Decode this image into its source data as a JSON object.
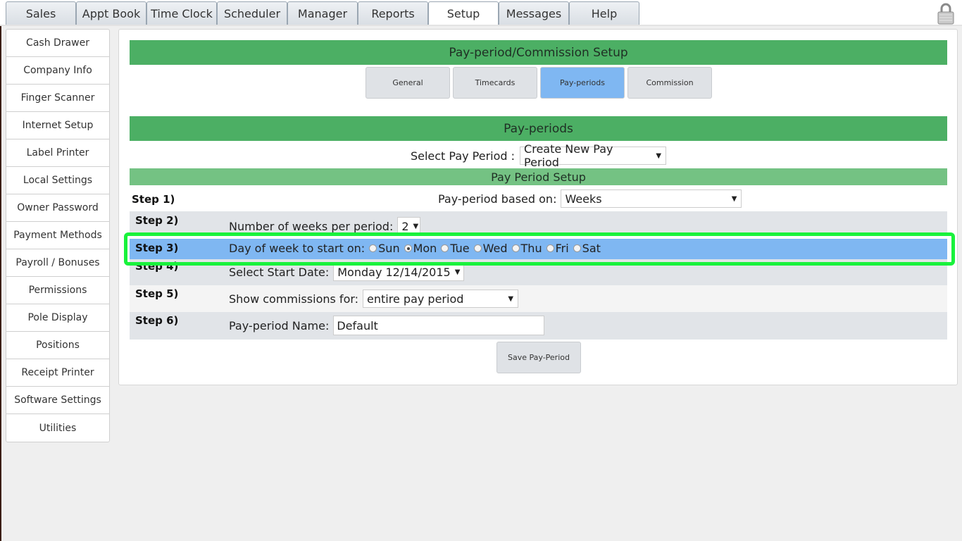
{
  "top_tabs": [
    "Sales",
    "Appt Book",
    "Time Clock",
    "Scheduler",
    "Manager",
    "Reports",
    "Setup",
    "Messages",
    "Help"
  ],
  "sidebar": [
    "Cash Drawer",
    "Company Info",
    "Finger Scanner",
    "Internet Setup",
    "Label Printer",
    "Local Settings",
    "Owner Password",
    "Payment Methods",
    "Payroll / Bonuses",
    "Permissions",
    "Pole Display",
    "Positions",
    "Receipt Printer",
    "Software Settings",
    "Utilities"
  ],
  "header": "Pay-period/Commission Setup",
  "sub_tabs": [
    "General",
    "Timecards",
    "Pay-periods",
    "Commission"
  ],
  "payperiods_title": "Pay-periods",
  "select_pay_period": {
    "label": "Select Pay Period :",
    "value": "Create New Pay Period"
  },
  "setup_title": "Pay Period Setup",
  "steps": {
    "s1": {
      "label": "Step 1)",
      "text": "Pay-period based on:",
      "value": "Weeks"
    },
    "s2": {
      "label": "Step 2)",
      "text": "Number of weeks per period:",
      "value": "2"
    },
    "s3": {
      "label": "Step 3)",
      "text": "Day of week to start on:",
      "days": [
        "Sun",
        "Mon",
        "Tue",
        "Wed",
        "Thu",
        "Fri",
        "Sat"
      ],
      "selected": "Mon"
    },
    "s4": {
      "label": "Step 4)",
      "text": "Select Start Date:",
      "value": "Monday 12/14/2015"
    },
    "s5": {
      "label": "Step 5)",
      "text": "Show commissions for:",
      "value": "entire pay period"
    },
    "s6": {
      "label": "Step 6)",
      "text": "Pay-period Name:",
      "value": "Default"
    }
  },
  "save_button": "Save Pay-Period",
  "colors": {
    "header_green": "#4caf64",
    "subheader_green": "#74c283",
    "active_blue": "#7fb7f2",
    "highlight": "#19f23c"
  },
  "icons": {
    "lock": "lock-icon"
  }
}
